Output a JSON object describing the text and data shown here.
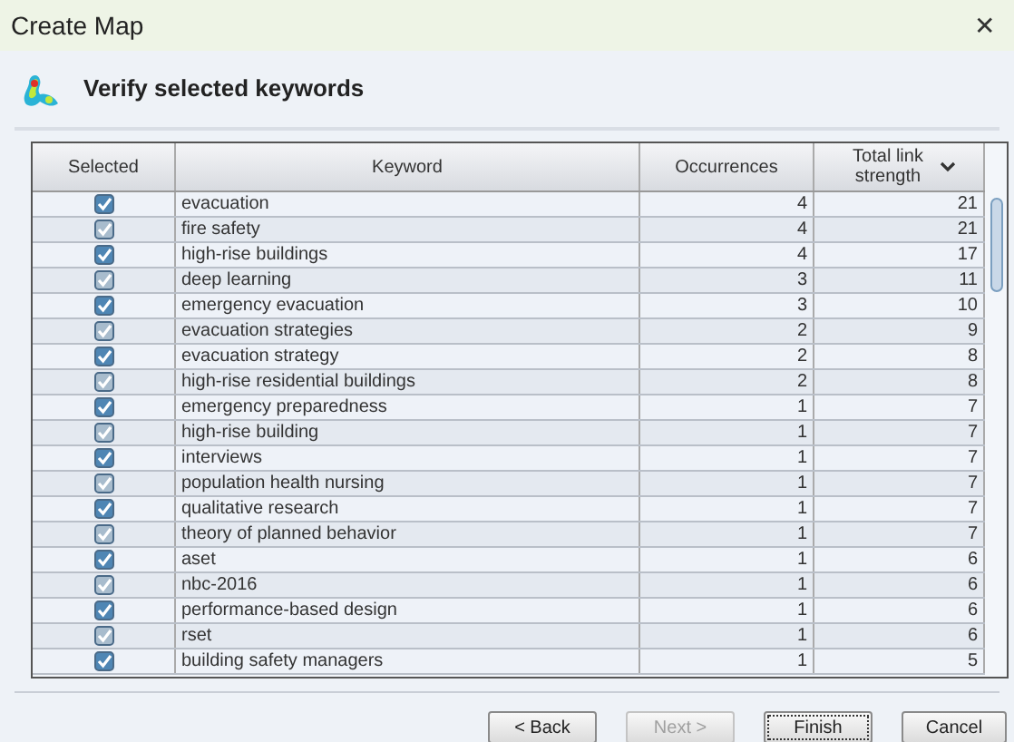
{
  "window": {
    "title": "Create Map",
    "close": "✕"
  },
  "heading": "Verify selected keywords",
  "table": {
    "columns": [
      {
        "label": "Selected",
        "sorted": false
      },
      {
        "label": "Keyword",
        "sorted": false
      },
      {
        "label": "Occurrences",
        "sorted": false
      },
      {
        "label": "Total link strength",
        "sorted": true
      }
    ],
    "rows": [
      {
        "selected": true,
        "keyword": "evacuation",
        "occurrences": "4",
        "strength": "21"
      },
      {
        "selected": true,
        "keyword": "fire safety",
        "occurrences": "4",
        "strength": "21"
      },
      {
        "selected": true,
        "keyword": "high-rise buildings",
        "occurrences": "4",
        "strength": "17"
      },
      {
        "selected": true,
        "keyword": "deep learning",
        "occurrences": "3",
        "strength": "11"
      },
      {
        "selected": true,
        "keyword": "emergency evacuation",
        "occurrences": "3",
        "strength": "10"
      },
      {
        "selected": true,
        "keyword": "evacuation strategies",
        "occurrences": "2",
        "strength": "9"
      },
      {
        "selected": true,
        "keyword": "evacuation strategy",
        "occurrences": "2",
        "strength": "8"
      },
      {
        "selected": true,
        "keyword": "high-rise residential buildings",
        "occurrences": "2",
        "strength": "8"
      },
      {
        "selected": true,
        "keyword": "emergency preparedness",
        "occurrences": "1",
        "strength": "7"
      },
      {
        "selected": true,
        "keyword": "high-rise building",
        "occurrences": "1",
        "strength": "7"
      },
      {
        "selected": true,
        "keyword": "interviews",
        "occurrences": "1",
        "strength": "7"
      },
      {
        "selected": true,
        "keyword": "population health nursing",
        "occurrences": "1",
        "strength": "7"
      },
      {
        "selected": true,
        "keyword": "qualitative research",
        "occurrences": "1",
        "strength": "7"
      },
      {
        "selected": true,
        "keyword": "theory of planned behavior",
        "occurrences": "1",
        "strength": "7"
      },
      {
        "selected": true,
        "keyword": "aset",
        "occurrences": "1",
        "strength": "6"
      },
      {
        "selected": true,
        "keyword": "nbc-2016",
        "occurrences": "1",
        "strength": "6"
      },
      {
        "selected": true,
        "keyword": "performance-based design",
        "occurrences": "1",
        "strength": "6"
      },
      {
        "selected": true,
        "keyword": "rset",
        "occurrences": "1",
        "strength": "6"
      },
      {
        "selected": true,
        "keyword": "building safety managers",
        "occurrences": "1",
        "strength": "5"
      }
    ]
  },
  "buttons": [
    {
      "label": "< Back",
      "disabled": false,
      "default": false
    },
    {
      "label": "Next >",
      "disabled": true,
      "default": false
    },
    {
      "label": "Finish",
      "disabled": false,
      "default": true
    },
    {
      "label": "Cancel",
      "disabled": false,
      "default": false
    }
  ]
}
